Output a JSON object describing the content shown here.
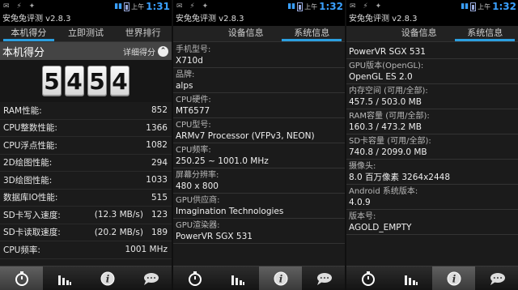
{
  "status_bar": {
    "ampm": "上午",
    "times": [
      "1:31",
      "1:32",
      "1:32"
    ]
  },
  "app_title": "安兔兔评测 v2.8.3",
  "screen1": {
    "tabs": [
      "本机得分",
      "立即测试",
      "世界排行"
    ],
    "score_header": "本机得分",
    "detail_label": "详细得分",
    "score_digits": [
      "5",
      "4",
      "5",
      "4"
    ],
    "metrics": [
      {
        "label": "RAM性能:",
        "extra": "",
        "value": "852"
      },
      {
        "label": "CPU整数性能:",
        "extra": "",
        "value": "1366"
      },
      {
        "label": "CPU浮点性能:",
        "extra": "",
        "value": "1082"
      },
      {
        "label": "2D绘图性能:",
        "extra": "",
        "value": "294"
      },
      {
        "label": "3D绘图性能:",
        "extra": "",
        "value": "1033"
      },
      {
        "label": "数据库IO性能:",
        "extra": "",
        "value": "515"
      },
      {
        "label": "SD卡写入速度:",
        "extra": "(12.3 MB/s)",
        "value": "123"
      },
      {
        "label": "SD卡读取速度:",
        "extra": "(20.2 MB/s)",
        "value": "189"
      },
      {
        "label": "CPU频率:",
        "extra": "",
        "value": "1001 MHz"
      }
    ]
  },
  "screen2": {
    "tabs": [
      "设备信息",
      "系统信息"
    ],
    "items": [
      {
        "label": "手机型号:",
        "value": "X710d"
      },
      {
        "label": "品牌:",
        "value": "alps"
      },
      {
        "label": "CPU硬件:",
        "value": "MT6577"
      },
      {
        "label": "CPU型号:",
        "value": "ARMv7 Processor (VFPv3, NEON)"
      },
      {
        "label": "CPU频率:",
        "value": "250.25 ~ 1001.0 MHz"
      },
      {
        "label": "屏幕分辨率:",
        "value": "480 x 800"
      },
      {
        "label": "GPU供应商:",
        "value": "Imagination Technologies"
      },
      {
        "label": "GPU渲染器:",
        "value": "PowerVR SGX 531"
      }
    ]
  },
  "screen3": {
    "tabs": [
      "设备信息",
      "系统信息"
    ],
    "top_value": "PowerVR SGX 531",
    "items": [
      {
        "label": "GPU版本(OpenGL):",
        "value": "OpenGL ES 2.0"
      },
      {
        "label": "内存空间 (可用/全部):",
        "value": "457.5 / 503.0 MB"
      },
      {
        "label": "RAM容量 (可用/全部):",
        "value": "160.3 / 473.2 MB"
      },
      {
        "label": "SD卡容量 (可用/全部):",
        "value": "740.8 / 2099.0 MB"
      },
      {
        "label": "摄像头:",
        "value": "8.0 百万像素   3264x2448"
      },
      {
        "label": "Android 系统版本:",
        "value": "4.0.9"
      },
      {
        "label": "版本号:",
        "value": "AGOLD_EMPTY"
      }
    ]
  },
  "bottom_nav": [
    "stopwatch-icon",
    "bar-chart-icon",
    "info-icon",
    "chat-bubble-icon"
  ],
  "colors": {
    "accent": "#2b9fe0",
    "background": "#1b1b1b",
    "time": "#3aa0ff"
  }
}
